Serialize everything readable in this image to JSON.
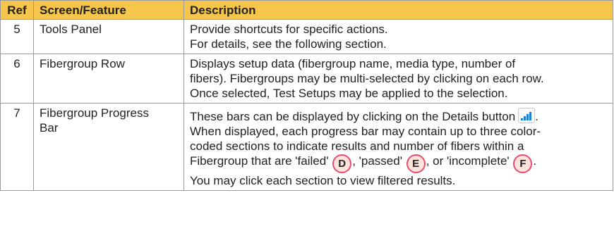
{
  "table": {
    "headers": {
      "ref": "Ref",
      "feature": "Screen/Feature",
      "description": "Description"
    },
    "rows": [
      {
        "ref": "5",
        "feature": "Tools Panel",
        "description_lines": [
          "Provide shortcuts for specific actions.",
          "For details, see the following section."
        ]
      },
      {
        "ref": "6",
        "feature": "Fibergroup Row",
        "description_lines": [
          "Displays setup data (fibergroup name, media type, number of",
          "fibers). Fibergroups may be multi-selected by clicking on each row.",
          "Once selected, Test Setups may be applied to the selection."
        ]
      },
      {
        "ref": "7",
        "feature_lines": [
          "Fibergroup Progress",
          "Bar"
        ],
        "desc_line1": "These bars can be displayed by clicking on the Details button",
        "desc_line1_end": ".",
        "details_icon": "signal-bars-icon",
        "desc_line2": "When displayed, each progress bar may contain up to three color-",
        "desc_line3": "coded sections to indicate results and number of fibers within a",
        "desc_line4_a": "Fibergroup that are 'failed'",
        "marker_d": "D",
        "desc_line4_b": ", 'passed'",
        "marker_e": "E",
        "desc_line4_c": ", or 'incomplete'",
        "marker_f": "F",
        "desc_line4_d": ".",
        "desc_line5": "You may click each section to view filtered results."
      }
    ]
  },
  "colors": {
    "header_bg": "#f5c64b",
    "marker_border": "#e94b6f",
    "marker_fill": "#fde3dc",
    "icon_blue": "#1d7fd6"
  }
}
